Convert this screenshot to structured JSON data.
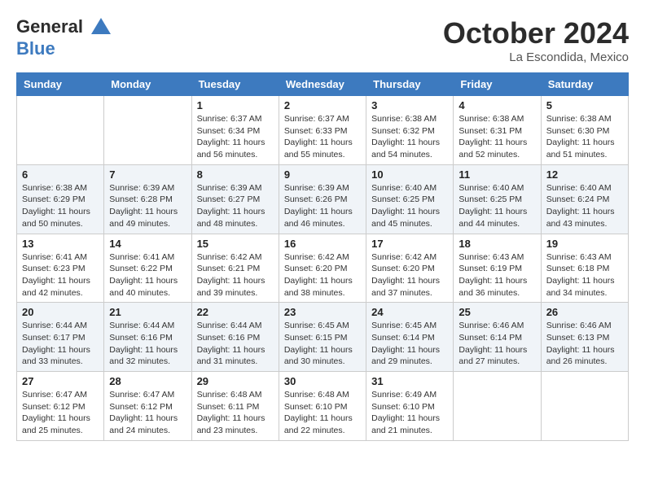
{
  "header": {
    "logo_line1": "General",
    "logo_line2": "Blue",
    "month_title": "October 2024",
    "location": "La Escondida, Mexico"
  },
  "weekdays": [
    "Sunday",
    "Monday",
    "Tuesday",
    "Wednesday",
    "Thursday",
    "Friday",
    "Saturday"
  ],
  "weeks": [
    [
      {
        "day": "",
        "sunrise": "",
        "sunset": "",
        "daylight": ""
      },
      {
        "day": "",
        "sunrise": "",
        "sunset": "",
        "daylight": ""
      },
      {
        "day": "1",
        "sunrise": "Sunrise: 6:37 AM",
        "sunset": "Sunset: 6:34 PM",
        "daylight": "Daylight: 11 hours and 56 minutes."
      },
      {
        "day": "2",
        "sunrise": "Sunrise: 6:37 AM",
        "sunset": "Sunset: 6:33 PM",
        "daylight": "Daylight: 11 hours and 55 minutes."
      },
      {
        "day": "3",
        "sunrise": "Sunrise: 6:38 AM",
        "sunset": "Sunset: 6:32 PM",
        "daylight": "Daylight: 11 hours and 54 minutes."
      },
      {
        "day": "4",
        "sunrise": "Sunrise: 6:38 AM",
        "sunset": "Sunset: 6:31 PM",
        "daylight": "Daylight: 11 hours and 52 minutes."
      },
      {
        "day": "5",
        "sunrise": "Sunrise: 6:38 AM",
        "sunset": "Sunset: 6:30 PM",
        "daylight": "Daylight: 11 hours and 51 minutes."
      }
    ],
    [
      {
        "day": "6",
        "sunrise": "Sunrise: 6:38 AM",
        "sunset": "Sunset: 6:29 PM",
        "daylight": "Daylight: 11 hours and 50 minutes."
      },
      {
        "day": "7",
        "sunrise": "Sunrise: 6:39 AM",
        "sunset": "Sunset: 6:28 PM",
        "daylight": "Daylight: 11 hours and 49 minutes."
      },
      {
        "day": "8",
        "sunrise": "Sunrise: 6:39 AM",
        "sunset": "Sunset: 6:27 PM",
        "daylight": "Daylight: 11 hours and 48 minutes."
      },
      {
        "day": "9",
        "sunrise": "Sunrise: 6:39 AM",
        "sunset": "Sunset: 6:26 PM",
        "daylight": "Daylight: 11 hours and 46 minutes."
      },
      {
        "day": "10",
        "sunrise": "Sunrise: 6:40 AM",
        "sunset": "Sunset: 6:25 PM",
        "daylight": "Daylight: 11 hours and 45 minutes."
      },
      {
        "day": "11",
        "sunrise": "Sunrise: 6:40 AM",
        "sunset": "Sunset: 6:25 PM",
        "daylight": "Daylight: 11 hours and 44 minutes."
      },
      {
        "day": "12",
        "sunrise": "Sunrise: 6:40 AM",
        "sunset": "Sunset: 6:24 PM",
        "daylight": "Daylight: 11 hours and 43 minutes."
      }
    ],
    [
      {
        "day": "13",
        "sunrise": "Sunrise: 6:41 AM",
        "sunset": "Sunset: 6:23 PM",
        "daylight": "Daylight: 11 hours and 42 minutes."
      },
      {
        "day": "14",
        "sunrise": "Sunrise: 6:41 AM",
        "sunset": "Sunset: 6:22 PM",
        "daylight": "Daylight: 11 hours and 40 minutes."
      },
      {
        "day": "15",
        "sunrise": "Sunrise: 6:42 AM",
        "sunset": "Sunset: 6:21 PM",
        "daylight": "Daylight: 11 hours and 39 minutes."
      },
      {
        "day": "16",
        "sunrise": "Sunrise: 6:42 AM",
        "sunset": "Sunset: 6:20 PM",
        "daylight": "Daylight: 11 hours and 38 minutes."
      },
      {
        "day": "17",
        "sunrise": "Sunrise: 6:42 AM",
        "sunset": "Sunset: 6:20 PM",
        "daylight": "Daylight: 11 hours and 37 minutes."
      },
      {
        "day": "18",
        "sunrise": "Sunrise: 6:43 AM",
        "sunset": "Sunset: 6:19 PM",
        "daylight": "Daylight: 11 hours and 36 minutes."
      },
      {
        "day": "19",
        "sunrise": "Sunrise: 6:43 AM",
        "sunset": "Sunset: 6:18 PM",
        "daylight": "Daylight: 11 hours and 34 minutes."
      }
    ],
    [
      {
        "day": "20",
        "sunrise": "Sunrise: 6:44 AM",
        "sunset": "Sunset: 6:17 PM",
        "daylight": "Daylight: 11 hours and 33 minutes."
      },
      {
        "day": "21",
        "sunrise": "Sunrise: 6:44 AM",
        "sunset": "Sunset: 6:16 PM",
        "daylight": "Daylight: 11 hours and 32 minutes."
      },
      {
        "day": "22",
        "sunrise": "Sunrise: 6:44 AM",
        "sunset": "Sunset: 6:16 PM",
        "daylight": "Daylight: 11 hours and 31 minutes."
      },
      {
        "day": "23",
        "sunrise": "Sunrise: 6:45 AM",
        "sunset": "Sunset: 6:15 PM",
        "daylight": "Daylight: 11 hours and 30 minutes."
      },
      {
        "day": "24",
        "sunrise": "Sunrise: 6:45 AM",
        "sunset": "Sunset: 6:14 PM",
        "daylight": "Daylight: 11 hours and 29 minutes."
      },
      {
        "day": "25",
        "sunrise": "Sunrise: 6:46 AM",
        "sunset": "Sunset: 6:14 PM",
        "daylight": "Daylight: 11 hours and 27 minutes."
      },
      {
        "day": "26",
        "sunrise": "Sunrise: 6:46 AM",
        "sunset": "Sunset: 6:13 PM",
        "daylight": "Daylight: 11 hours and 26 minutes."
      }
    ],
    [
      {
        "day": "27",
        "sunrise": "Sunrise: 6:47 AM",
        "sunset": "Sunset: 6:12 PM",
        "daylight": "Daylight: 11 hours and 25 minutes."
      },
      {
        "day": "28",
        "sunrise": "Sunrise: 6:47 AM",
        "sunset": "Sunset: 6:12 PM",
        "daylight": "Daylight: 11 hours and 24 minutes."
      },
      {
        "day": "29",
        "sunrise": "Sunrise: 6:48 AM",
        "sunset": "Sunset: 6:11 PM",
        "daylight": "Daylight: 11 hours and 23 minutes."
      },
      {
        "day": "30",
        "sunrise": "Sunrise: 6:48 AM",
        "sunset": "Sunset: 6:10 PM",
        "daylight": "Daylight: 11 hours and 22 minutes."
      },
      {
        "day": "31",
        "sunrise": "Sunrise: 6:49 AM",
        "sunset": "Sunset: 6:10 PM",
        "daylight": "Daylight: 11 hours and 21 minutes."
      },
      {
        "day": "",
        "sunrise": "",
        "sunset": "",
        "daylight": ""
      },
      {
        "day": "",
        "sunrise": "",
        "sunset": "",
        "daylight": ""
      }
    ]
  ]
}
